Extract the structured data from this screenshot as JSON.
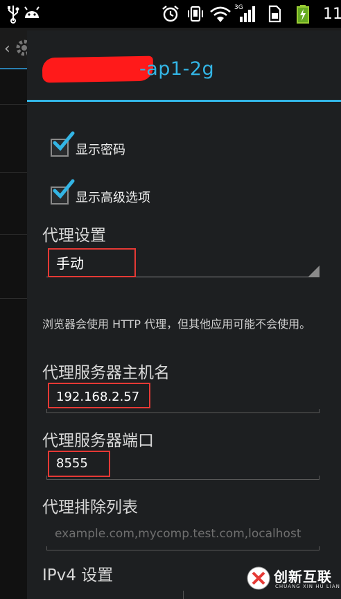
{
  "status_bar": {
    "time": "11",
    "icons": [
      "usb-icon",
      "android-debug-icon",
      "alarm-icon",
      "vibrate-icon",
      "wifi-icon",
      "signal-3g-icon",
      "sim-icon",
      "battery-charging-icon"
    ],
    "network_label": "3G"
  },
  "dialog": {
    "title_suffix": "-ap1-2g",
    "show_password_label": "显示密码",
    "show_password_checked": true,
    "show_advanced_label": "显示高级选项",
    "show_advanced_checked": true,
    "proxy_settings_label": "代理设置",
    "proxy_mode_value": "手动",
    "proxy_note": "浏览器会使用 HTTP 代理，但其他应用可能不会使用。",
    "proxy_host_label": "代理服务器主机名",
    "proxy_host_value": "192.168.2.57",
    "proxy_port_label": "代理服务器端口",
    "proxy_port_value": "8555",
    "proxy_bypass_label": "代理排除列表",
    "proxy_bypass_placeholder": "example.com,mycomp.test.com,localhost",
    "ipv4_label": "IPv4 设置"
  },
  "watermark": {
    "name_cn": "创新互联",
    "name_en": "CHUANG XIN HU LIAN"
  },
  "colors": {
    "accent": "#33b5e5",
    "highlight_box": "#e53935",
    "redaction": "#ff1a1a"
  }
}
